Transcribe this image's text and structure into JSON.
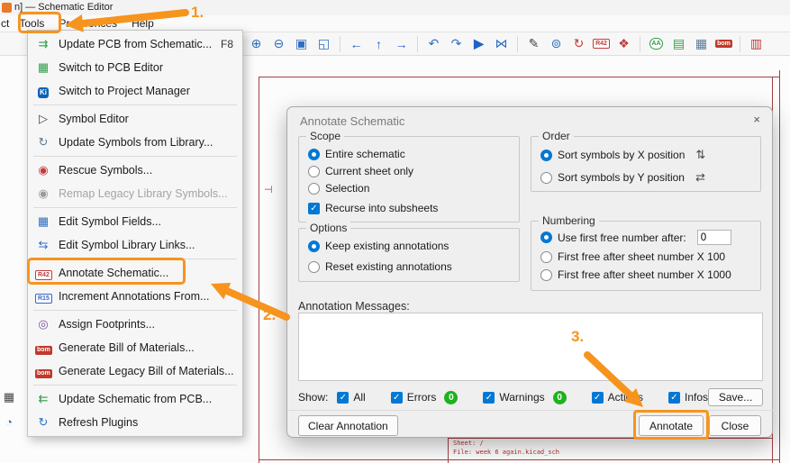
{
  "window": {
    "title": "n] — Schematic Editor",
    "menu_partial": "ct",
    "menus": {
      "tools": "Tools",
      "preferences": "Preferences",
      "help": "Help"
    }
  },
  "toolbar": {
    "icons": [
      {
        "name": "zoom-in-icon",
        "glyph": "⊕"
      },
      {
        "name": "zoom-out-icon",
        "glyph": "⊖"
      },
      {
        "name": "zoom-fit-icon",
        "glyph": "▣"
      },
      {
        "name": "zoom-selection-icon",
        "glyph": "◱"
      },
      {
        "name": "nav-left-icon",
        "glyph": "←"
      },
      {
        "name": "nav-up-icon",
        "glyph": "↑"
      },
      {
        "name": "nav-right-icon",
        "glyph": "→"
      },
      {
        "name": "undo-icon",
        "glyph": "↶"
      },
      {
        "name": "redo-icon",
        "glyph": "↷"
      },
      {
        "name": "simulate-icon",
        "glyph": "▶"
      },
      {
        "name": "mirror-icon",
        "glyph": "⋈"
      },
      {
        "name": "schematic-setup-icon",
        "glyph": "✎"
      },
      {
        "name": "search-icon",
        "glyph": "⊚"
      },
      {
        "name": "update-symbols-icon",
        "glyph": "↻"
      },
      {
        "name": "annotate-toolbar-icon",
        "glyph": "R42"
      },
      {
        "name": "erc-icon",
        "glyph": "❖"
      },
      {
        "name": "text-size-icon",
        "glyph": "AA"
      },
      {
        "name": "assign-footprints-icon",
        "glyph": "▤"
      },
      {
        "name": "symbol-fields-table-icon",
        "glyph": "▦"
      },
      {
        "name": "bom-icon",
        "glyph": "bom"
      },
      {
        "name": "edge-partial-icon",
        "glyph": "▥"
      }
    ]
  },
  "left_toolbar": {
    "icons": [
      {
        "name": "grid-icon",
        "glyph": "▦"
      },
      {
        "name": "units-icon",
        "glyph": "◔"
      }
    ]
  },
  "tools_menu": {
    "items": [
      {
        "label": "Update PCB from Schematic...",
        "shortcut": "F8",
        "icon": "⇉"
      },
      {
        "label": "Switch to PCB Editor",
        "icon": "▦"
      },
      {
        "label": "Switch to Project Manager",
        "icon": "Ki"
      },
      {
        "label": "Symbol Editor",
        "icon": "▷"
      },
      {
        "label": "Update Symbols from Library...",
        "icon": "↻"
      },
      {
        "label": "Rescue Symbols...",
        "icon": "◉"
      },
      {
        "label": "Remap Legacy Library Symbols...",
        "icon": "◉"
      },
      {
        "label": "Edit Symbol Fields...",
        "icon": "▦"
      },
      {
        "label": "Edit Symbol Library Links...",
        "icon": "⇆"
      },
      {
        "label": "Annotate Schematic...",
        "icon": "R42"
      },
      {
        "label": "Increment Annotations From...",
        "icon": "R15"
      },
      {
        "label": "Assign Footprints...",
        "icon": "◎"
      },
      {
        "label": "Generate Bill of Materials...",
        "icon": "bom"
      },
      {
        "label": "Generate Legacy Bill of Materials...",
        "icon": "bom"
      },
      {
        "label": "Update Schematic from PCB...",
        "icon": "⇇"
      },
      {
        "label": "Refresh Plugins",
        "icon": "↻"
      }
    ]
  },
  "dialog": {
    "title": "Annotate Schematic",
    "close_glyph": "×",
    "scope": {
      "legend": "Scope",
      "options": [
        "Entire schematic",
        "Current sheet only",
        "Selection"
      ],
      "selected": "Entire schematic",
      "recurse_label": "Recurse into subsheets",
      "recurse_checked": true
    },
    "order": {
      "legend": "Order",
      "options": [
        "Sort symbols by X position",
        "Sort symbols by Y position"
      ],
      "selected": "Sort symbols by X position",
      "icon_x": "⇅",
      "icon_y": "⇄"
    },
    "options": {
      "legend": "Options",
      "options": [
        "Keep existing annotations",
        "Reset existing annotations"
      ],
      "selected": "Keep existing annotations"
    },
    "numbering": {
      "legend": "Numbering",
      "options": [
        "Use first free number after:",
        "First free after sheet number X 100",
        "First free after sheet number X 1000"
      ],
      "selected": "Use first free number after:",
      "first_free_value": "0"
    },
    "messages_label": "Annotation Messages:",
    "messages_text": "",
    "filters": {
      "show_label": "Show:",
      "all": "All",
      "errors": "Errors",
      "errors_count": "0",
      "warnings": "Warnings",
      "warnings_count": "0",
      "actions": "Actions",
      "infos": "Infos",
      "save_button": "Save..."
    },
    "buttons": {
      "clear": "Clear Annotation",
      "annotate": "Annotate",
      "close": "Close"
    }
  },
  "canvas": {
    "fragment_glyph": "⊣",
    "title_block": {
      "sheet": "Sheet: /",
      "file": "File: week 6 again.kicad_sch"
    }
  },
  "callouts": {
    "step1": "1.",
    "step2": "2.",
    "step3": "3."
  },
  "colors": {
    "highlight": "#f7941d",
    "accent_blue": "#0078d4",
    "badge_green": "#1db31d",
    "sheet_red": "#a34040"
  }
}
